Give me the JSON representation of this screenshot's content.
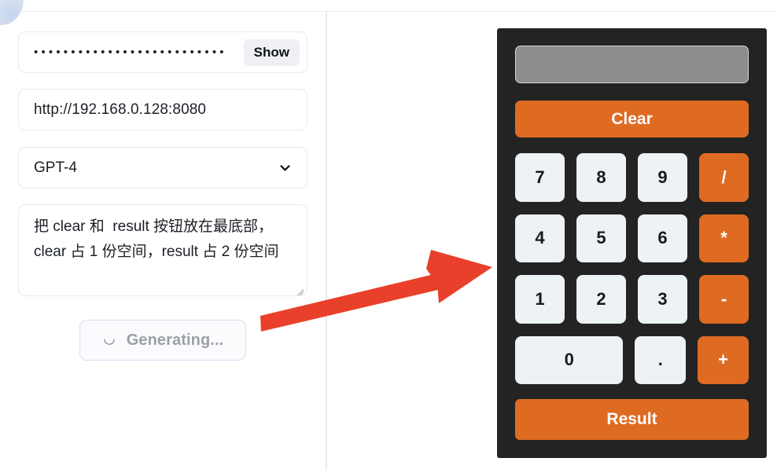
{
  "left_panel": {
    "password_field": {
      "masked_value": "••••••••••••••••••••••••••",
      "show_button_label": "Show"
    },
    "url_field": {
      "value": "http://192.168.0.128:8080"
    },
    "model_select": {
      "selected": "GPT-4",
      "chevron_icon": "chevron-down-icon"
    },
    "prompt_textarea": {
      "value": "把 clear 和  result 按钮放在最底部，clear 占 1 份空间，result 占 2 份空间"
    },
    "generate_button": {
      "label": "Generating...",
      "spinner_icon": "spinner-icon",
      "state": "loading"
    }
  },
  "annotation": {
    "arrow_icon": "red-arrow-icon",
    "color": "#e8402a"
  },
  "calculator": {
    "display_value": "",
    "clear_label": "Clear",
    "result_label": "Result",
    "colors": {
      "body": "#232323",
      "accent": "#df6b23",
      "key": "#edf2f5",
      "display": "#8d8d8d"
    },
    "rows": [
      [
        {
          "label": "7",
          "type": "digit"
        },
        {
          "label": "8",
          "type": "digit"
        },
        {
          "label": "9",
          "type": "digit"
        },
        {
          "label": "/",
          "type": "operator"
        }
      ],
      [
        {
          "label": "4",
          "type": "digit"
        },
        {
          "label": "5",
          "type": "digit"
        },
        {
          "label": "6",
          "type": "digit"
        },
        {
          "label": "*",
          "type": "operator"
        }
      ],
      [
        {
          "label": "1",
          "type": "digit"
        },
        {
          "label": "2",
          "type": "digit"
        },
        {
          "label": "3",
          "type": "digit"
        },
        {
          "label": "-",
          "type": "operator"
        }
      ],
      [
        {
          "label": "0",
          "type": "digit",
          "wide": true
        },
        {
          "label": ".",
          "type": "digit"
        },
        {
          "label": "+",
          "type": "operator"
        }
      ]
    ]
  }
}
